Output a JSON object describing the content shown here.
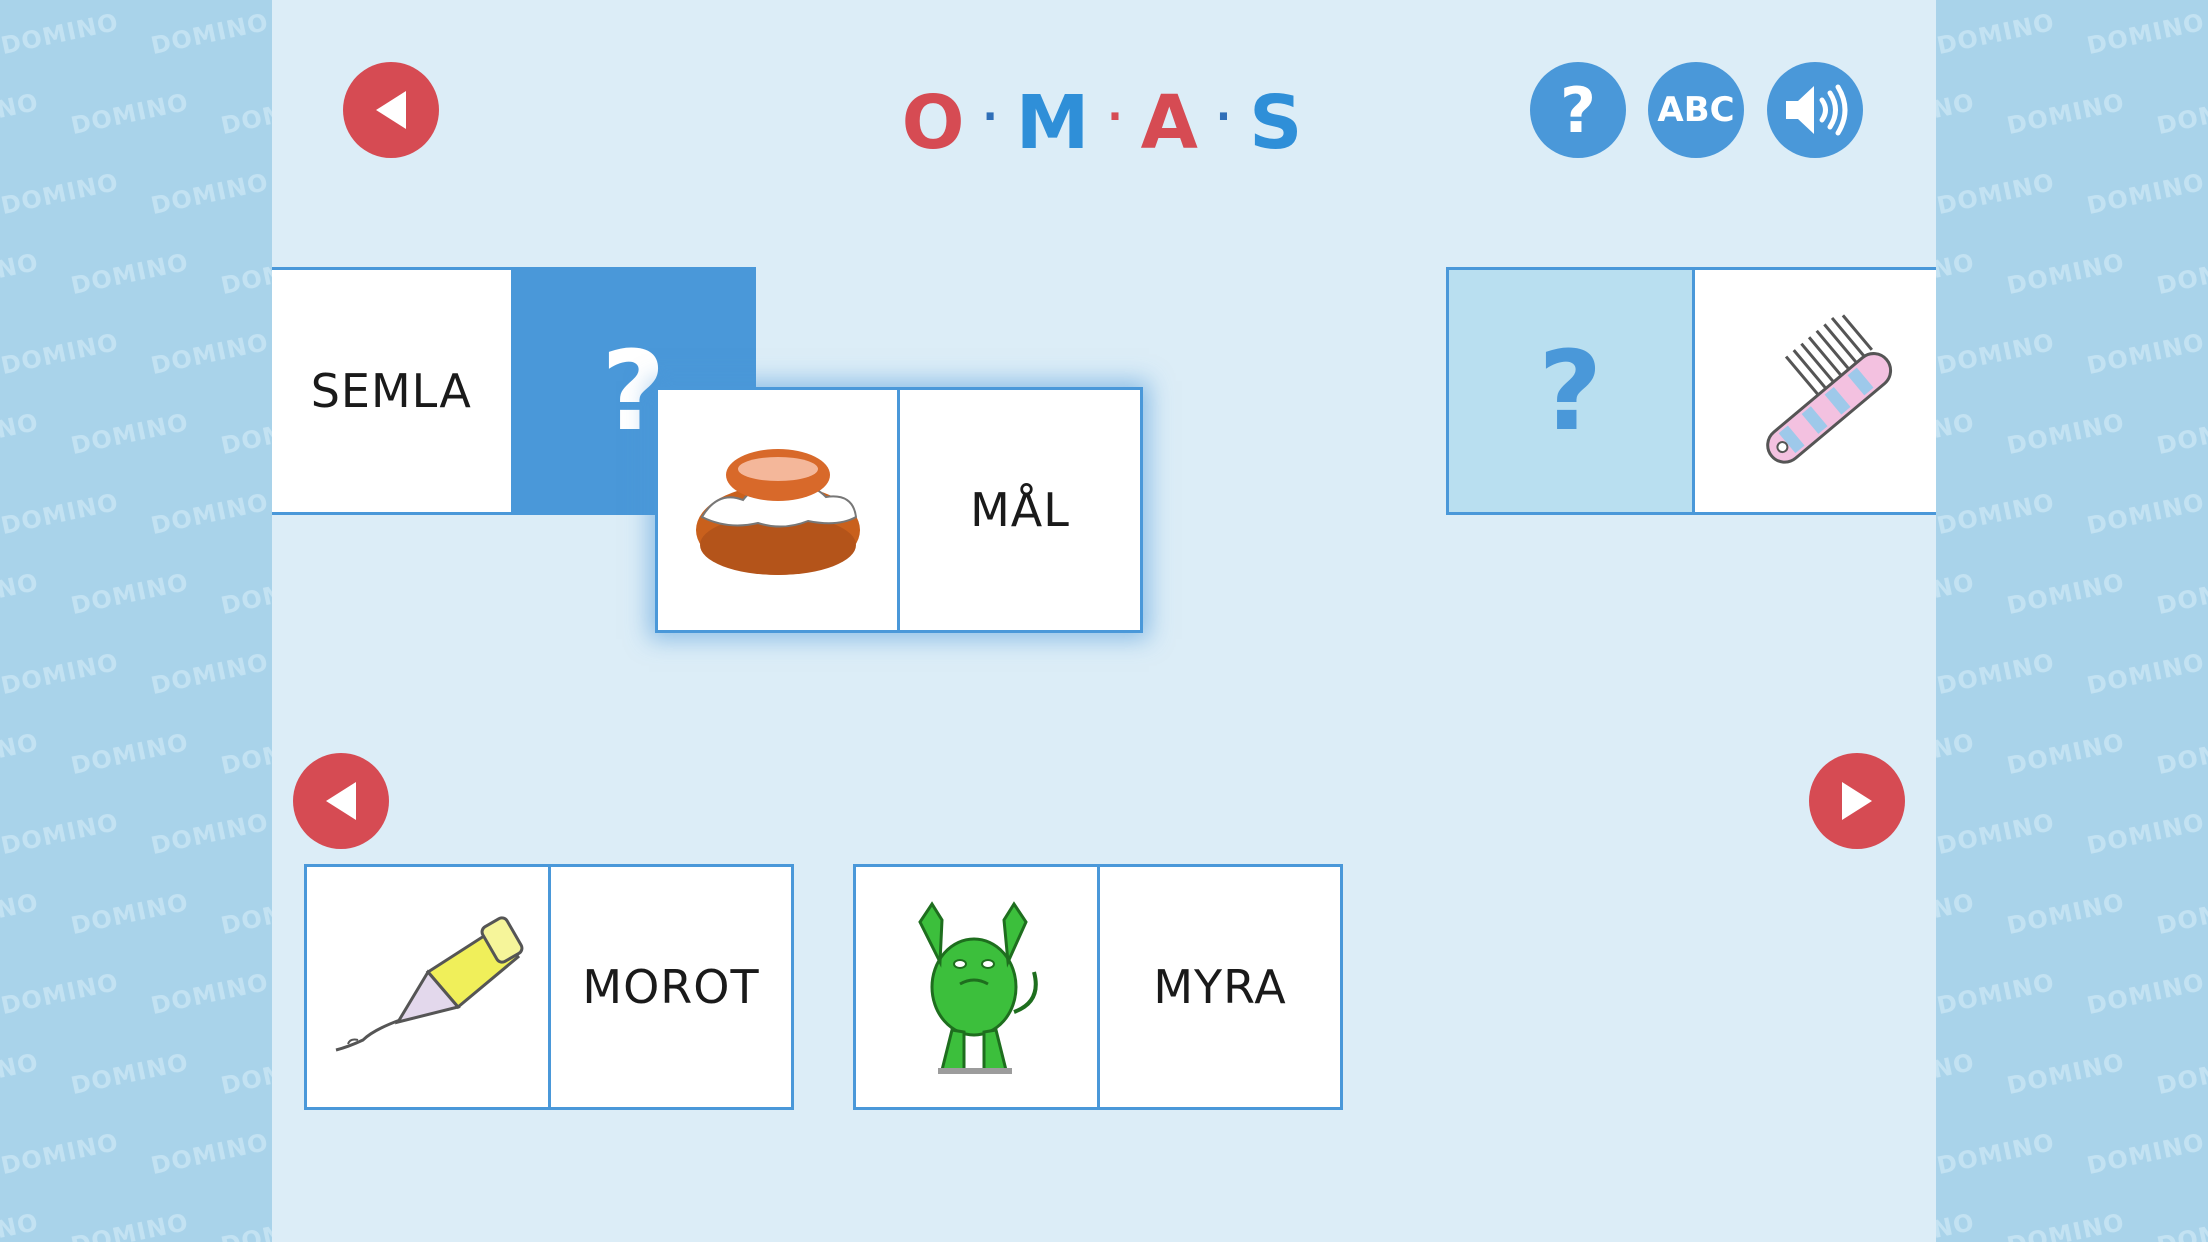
{
  "watermark": "DOMINO",
  "header": {
    "title_letters": [
      {
        "char": "O",
        "color": "#d64b53"
      },
      {
        "char": "M",
        "color": "#2f8fd8"
      },
      {
        "char": "A",
        "color": "#d64b53"
      },
      {
        "char": "S",
        "color": "#2f8fd8"
      }
    ],
    "separator": "·",
    "help_label": "?",
    "abc_label": "ABC"
  },
  "board": {
    "placed_left": {
      "word": "SEMLA",
      "slot": "?"
    },
    "placed_right": {
      "slot": "?",
      "image": "comb"
    },
    "dragging": {
      "image": "semla-bun",
      "word": "MÅL"
    }
  },
  "hand": [
    {
      "image": "glue-tube",
      "word": "MOROT"
    },
    {
      "image": "green-monster",
      "word": "MYRA"
    }
  ],
  "colors": {
    "red": "#d64b53",
    "blue": "#4a98d9",
    "light_blue": "#b9dff0",
    "background": "#dcedf7",
    "side_panel": "#a9d3ea"
  }
}
